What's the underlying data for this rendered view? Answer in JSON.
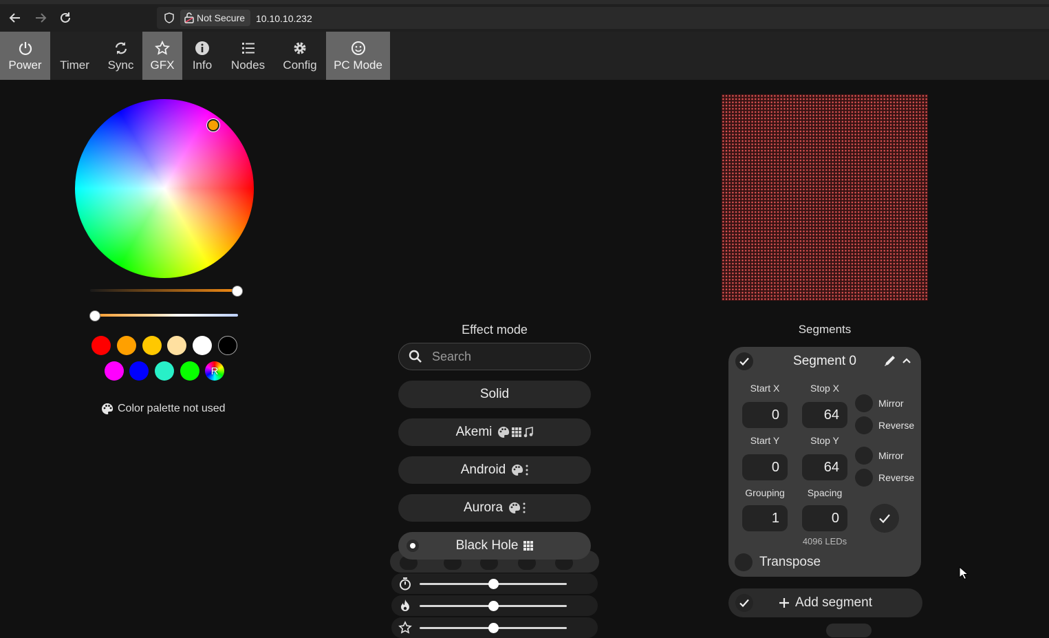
{
  "browser": {
    "security_label": "Not Secure",
    "url": "10.10.10.232"
  },
  "menu": {
    "tabs": [
      {
        "label": "Power",
        "icon": "power-icon",
        "active": true
      },
      {
        "label": "Timer",
        "icon": "moon-icon",
        "active": false
      },
      {
        "label": "Sync",
        "icon": "sync-icon",
        "active": false
      },
      {
        "label": "GFX",
        "icon": "star-icon",
        "active": true
      },
      {
        "label": "Info",
        "icon": "info-icon",
        "active": false
      },
      {
        "label": "Nodes",
        "icon": "list-icon",
        "active": false
      },
      {
        "label": "Config",
        "icon": "gear-icon",
        "active": false
      },
      {
        "label": "PC Mode",
        "icon": "smiley-icon",
        "active": true
      }
    ]
  },
  "color": {
    "selected_color": "#f7a000",
    "brightness_level": 1.0,
    "kelvin_level": 0.0,
    "quick_colors": [
      "#ff0000",
      "#ffa000",
      "#ffc800",
      "#ffe0a0",
      "#ffffff",
      "#000000",
      "#ff00ff",
      "#0000ff",
      "#28f0c8",
      "#08ff00"
    ],
    "random_label": "R",
    "palette_note": "Color palette not used"
  },
  "effects": {
    "title": "Effect mode",
    "search_placeholder": "Search",
    "list": [
      {
        "name": "Solid",
        "flags": ""
      },
      {
        "name": "Akemi",
        "flags": "palette matrix music"
      },
      {
        "name": "Android",
        "flags": "palette strip"
      },
      {
        "name": "Aurora",
        "flags": "palette strip"
      },
      {
        "name": "Black Hole",
        "flags": "matrix",
        "selected": true
      }
    ],
    "speed_level": 0.5,
    "intensity_level": 0.5,
    "custom_level": 0.5
  },
  "segments": {
    "title": "Segments",
    "segment": {
      "name": "Segment 0",
      "start_x_label": "Start X",
      "stop_x_label": "Stop X",
      "start_x": "0",
      "stop_x": "64",
      "start_y_label": "Start Y",
      "stop_y_label": "Stop Y",
      "start_y": "0",
      "stop_y": "64",
      "mirror_label": "Mirror",
      "reverse_label": "Reverse",
      "grouping_label": "Grouping",
      "spacing_label": "Spacing",
      "grouping": "1",
      "spacing": "0",
      "led_count": "4096 LEDs",
      "transpose_label": "Transpose"
    },
    "add_label": "Add segment"
  }
}
